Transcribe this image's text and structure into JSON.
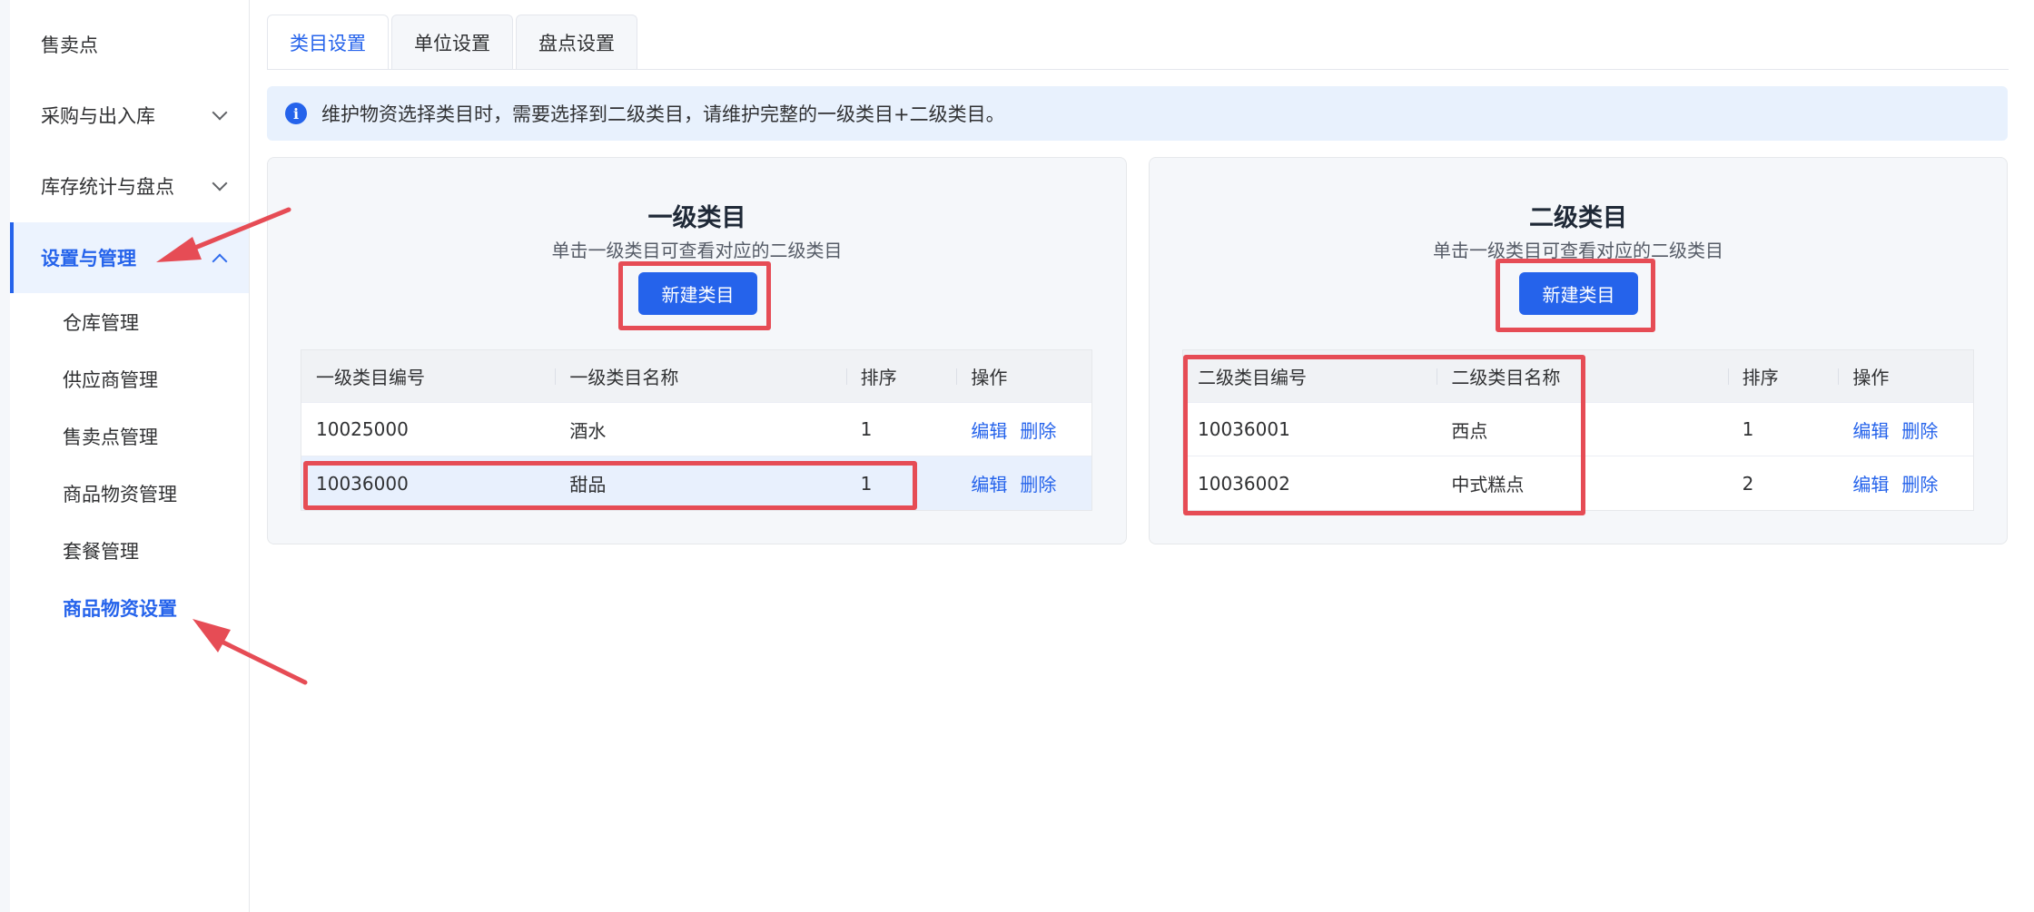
{
  "sidebar": {
    "items": [
      {
        "label": "售卖点"
      },
      {
        "label": "采购与出入库"
      },
      {
        "label": "库存统计与盘点"
      },
      {
        "label": "设置与管理"
      }
    ],
    "sub_items": [
      {
        "label": "仓库管理"
      },
      {
        "label": "供应商管理"
      },
      {
        "label": "售卖点管理"
      },
      {
        "label": "商品物资管理"
      },
      {
        "label": "套餐管理"
      },
      {
        "label": "商品物资设置"
      }
    ]
  },
  "tabs": [
    {
      "label": "类目设置"
    },
    {
      "label": "单位设置"
    },
    {
      "label": "盘点设置"
    }
  ],
  "alert": {
    "text": "维护物资选择类目时，需要选择到二级类目，请维护完整的一级类目+二级类目。"
  },
  "level1": {
    "title": "一级类目",
    "subtitle": "单击一级类目可查看对应的二级类目",
    "new_button": "新建类目",
    "columns": [
      "一级类目编号",
      "一级类目名称",
      "排序",
      "操作"
    ],
    "rows": [
      {
        "code": "10025000",
        "name": "酒水",
        "order": "1",
        "edit": "编辑",
        "delete": "删除"
      },
      {
        "code": "10036000",
        "name": "甜品",
        "order": "1",
        "edit": "编辑",
        "delete": "删除"
      }
    ]
  },
  "level2": {
    "title": "二级类目",
    "subtitle": "单击一级类目可查看对应的二级类目",
    "new_button": "新建类目",
    "columns": [
      "二级类目编号",
      "二级类目名称",
      "排序",
      "操作"
    ],
    "rows": [
      {
        "code": "10036001",
        "name": "西点",
        "order": "1",
        "edit": "编辑",
        "delete": "删除"
      },
      {
        "code": "10036002",
        "name": "中式糕点",
        "order": "2",
        "edit": "编辑",
        "delete": "删除"
      }
    ]
  },
  "colors": {
    "accent": "#2563eb",
    "annotation": "#e64c55"
  }
}
